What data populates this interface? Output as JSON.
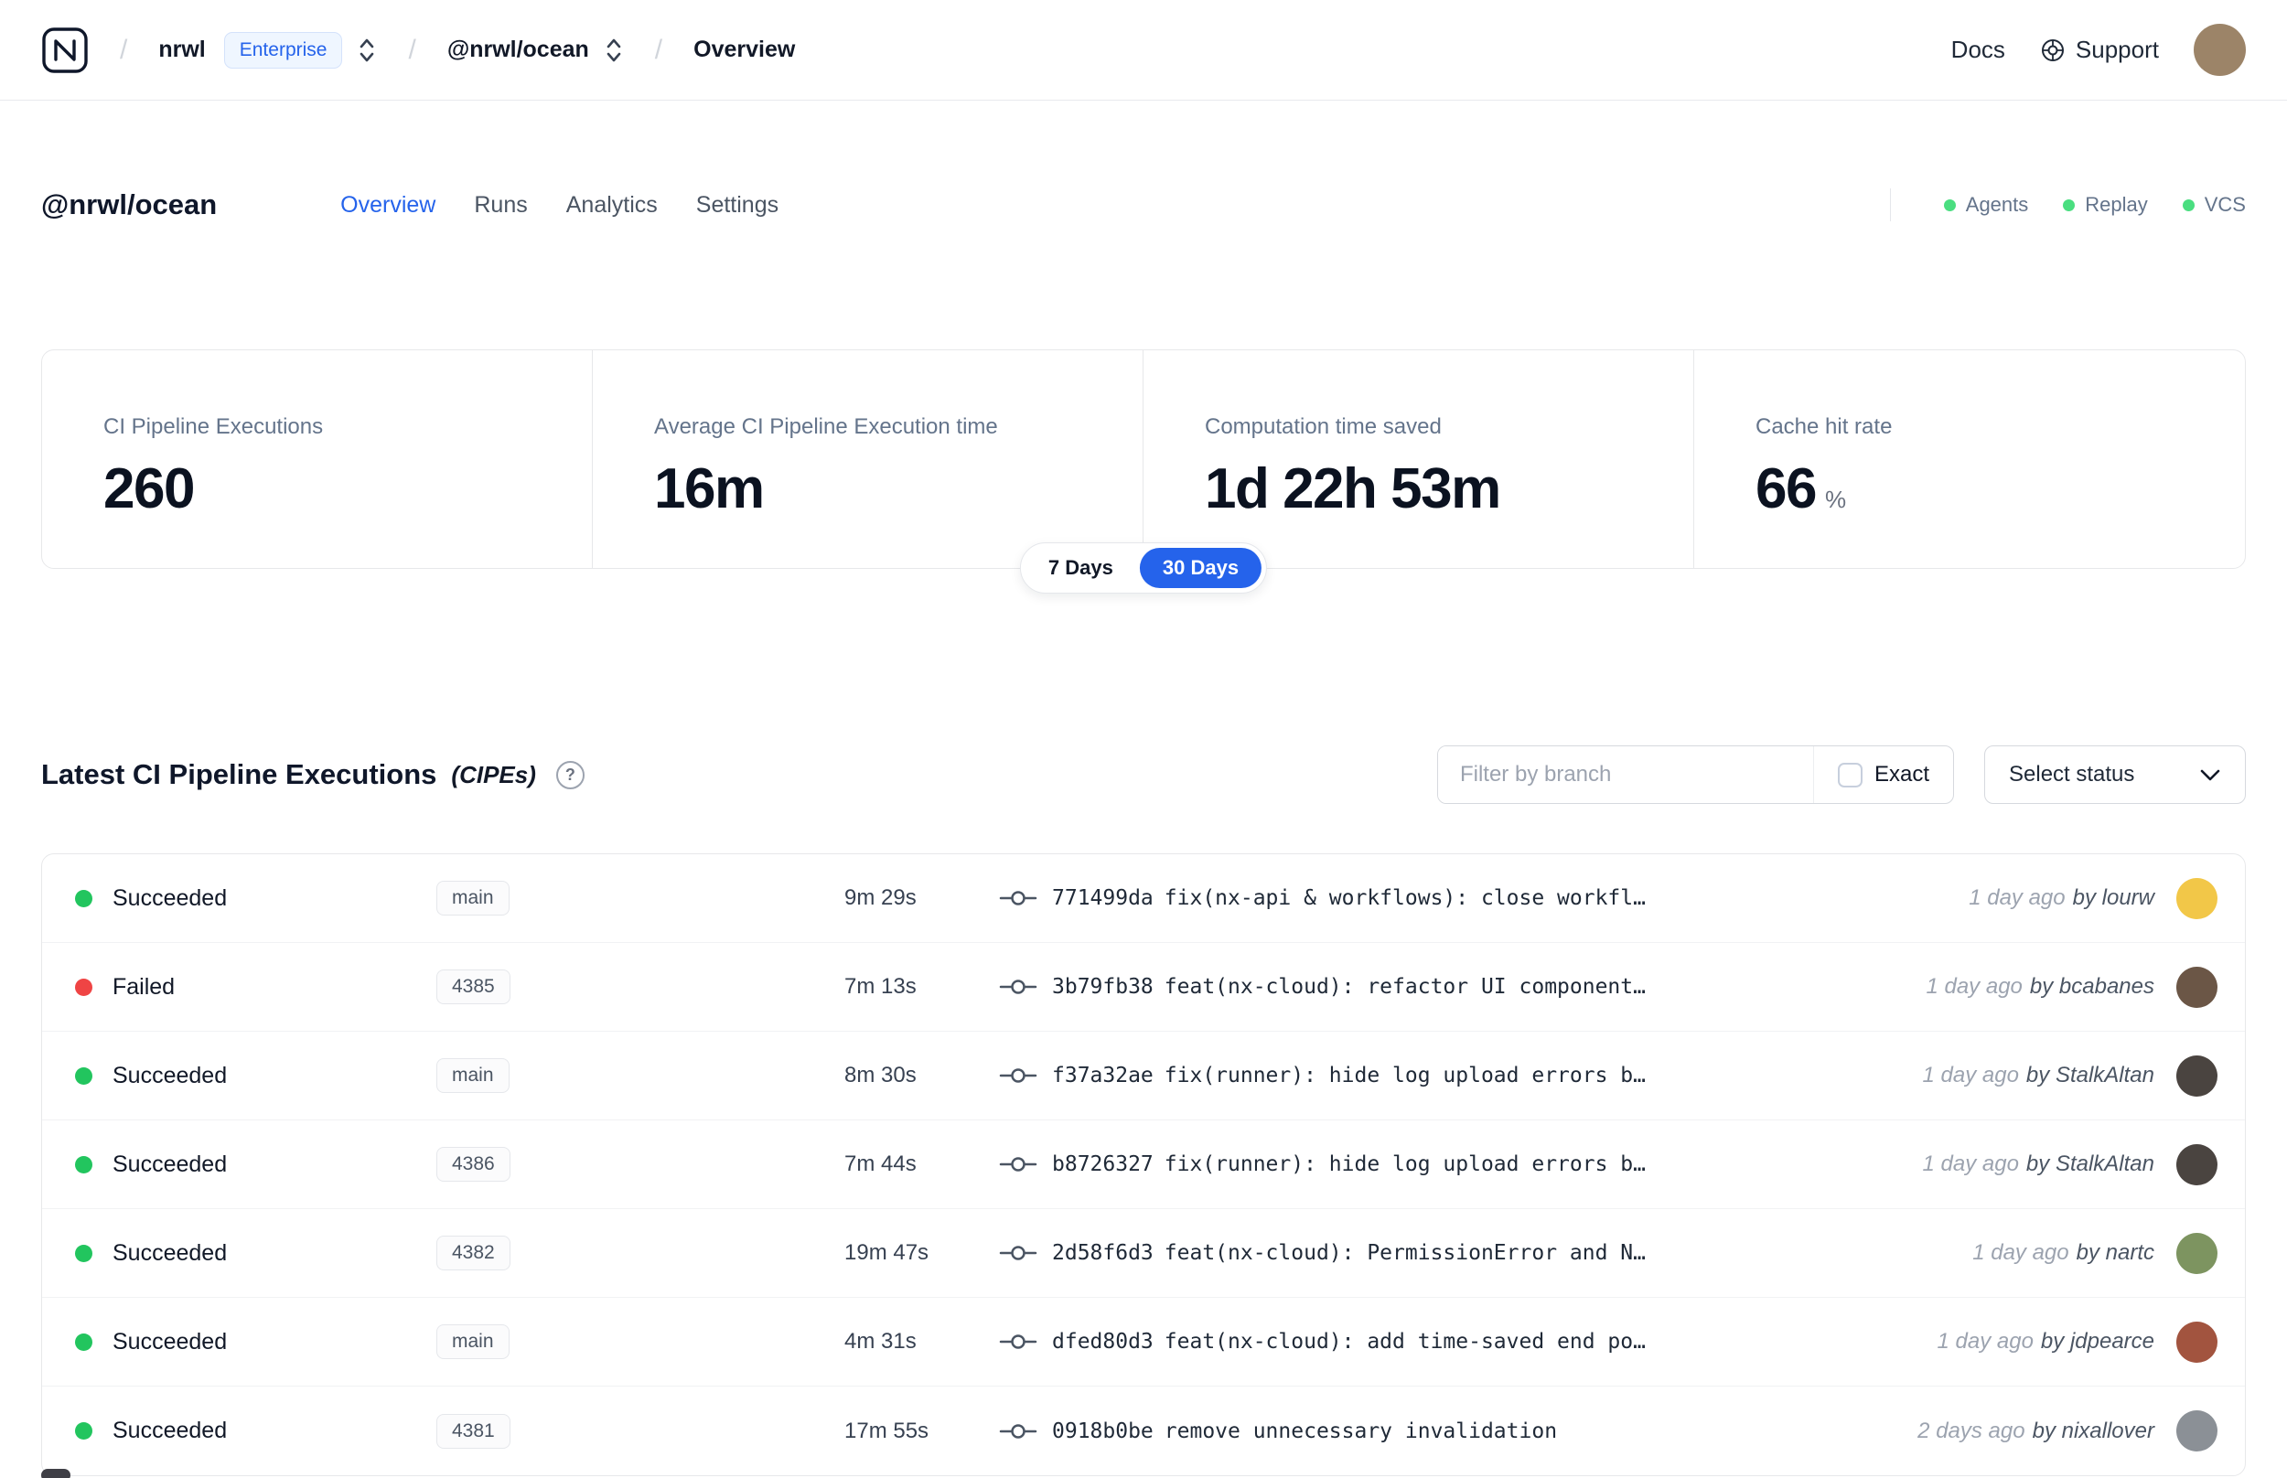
{
  "theme": {
    "accent": "#2563eb",
    "success": "#22c55e",
    "danger": "#ef4444",
    "feature_dot": "#4ade80"
  },
  "nav": {
    "separator": "/",
    "org": "nrwl",
    "org_badge": "Enterprise",
    "workspace": "@nrwl/ocean",
    "page": "Overview",
    "docs_label": "Docs",
    "support_label": "Support",
    "avatar_color": "#9c8468"
  },
  "header": {
    "title": "@nrwl/ocean",
    "tabs": [
      {
        "label": "Overview",
        "active": true
      },
      {
        "label": "Runs",
        "active": false
      },
      {
        "label": "Analytics",
        "active": false
      },
      {
        "label": "Settings",
        "active": false
      }
    ],
    "features": [
      {
        "label": "Agents"
      },
      {
        "label": "Replay"
      },
      {
        "label": "VCS"
      }
    ]
  },
  "stats": {
    "cards": [
      {
        "label": "CI Pipeline Executions",
        "value": "260"
      },
      {
        "label": "Average CI Pipeline Execution time",
        "value": "16m"
      },
      {
        "label": "Computation time saved",
        "value": "1d 22h 53m"
      },
      {
        "label": "Cache hit rate",
        "value": "66",
        "suffix": "%"
      }
    ],
    "range_toggle": {
      "options": [
        "7 Days",
        "30 Days"
      ],
      "selected": "30 Days"
    }
  },
  "cipes": {
    "title": "Latest CI Pipeline Executions",
    "title_suffix": "(CIPEs)",
    "help": "?",
    "filter_placeholder": "Filter by branch",
    "exact_label": "Exact",
    "status_button": "Select status"
  },
  "table": {
    "rows": [
      {
        "status": "Succeeded",
        "status_color": "#22c55e",
        "branch": "main",
        "duration": "9m 29s",
        "sha": "771499da",
        "message": "fix(nx-api & workflows): close workfl…",
        "time": "1 day ago",
        "author": "by lourw",
        "avatar_color": "#f2c748"
      },
      {
        "status": "Failed",
        "status_color": "#ef4444",
        "branch": "4385",
        "duration": "7m 13s",
        "sha": "3b79fb38",
        "message": "feat(nx-cloud): refactor UI component…",
        "time": "1 day ago",
        "author": "by bcabanes",
        "avatar_color": "#6b5646"
      },
      {
        "status": "Succeeded",
        "status_color": "#22c55e",
        "branch": "main",
        "duration": "8m 30s",
        "sha": "f37a32ae",
        "message": "fix(runner): hide log upload errors b…",
        "time": "1 day ago",
        "author": "by StalkAltan",
        "avatar_color": "#4a4440"
      },
      {
        "status": "Succeeded",
        "status_color": "#22c55e",
        "branch": "4386",
        "duration": "7m 44s",
        "sha": "b8726327",
        "message": "fix(runner): hide log upload errors b…",
        "time": "1 day ago",
        "author": "by StalkAltan",
        "avatar_color": "#4a4440"
      },
      {
        "status": "Succeeded",
        "status_color": "#22c55e",
        "branch": "4382",
        "duration": "19m 47s",
        "sha": "2d58f6d3",
        "message": "feat(nx-cloud): PermissionError and N…",
        "time": "1 day ago",
        "author": "by nartc",
        "avatar_color": "#7d9460"
      },
      {
        "status": "Succeeded",
        "status_color": "#22c55e",
        "branch": "main",
        "duration": "4m 31s",
        "sha": "dfed80d3",
        "message": "feat(nx-cloud): add time-saved end po…",
        "time": "1 day ago",
        "author": "by jdpearce",
        "avatar_color": "#a2543f"
      },
      {
        "status": "Succeeded",
        "status_color": "#22c55e",
        "branch": "4381",
        "duration": "17m 55s",
        "sha": "0918b0be",
        "message": "remove unnecessary invalidation",
        "time": "2 days ago",
        "author": "by nixallover",
        "avatar_color": "#8b9096"
      }
    ]
  }
}
